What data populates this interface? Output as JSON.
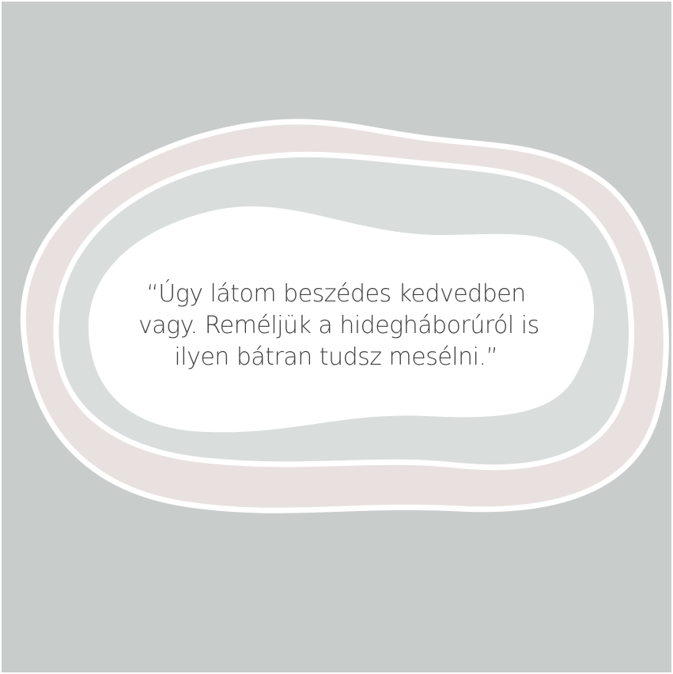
{
  "quote": {
    "lines": [
      "“Úgy látom beszédes kedvedben",
      "vagy. Reméljük a hidegháborúról is",
      "ilyen bátran tudsz mesélni.”"
    ]
  },
  "colors": {
    "background": "#c8cdcc",
    "outer_ring": "#e9e1df",
    "inner_ring": "#d9dedd",
    "center": "#ffffff",
    "outline": "#ffffff",
    "text": "#404040"
  }
}
